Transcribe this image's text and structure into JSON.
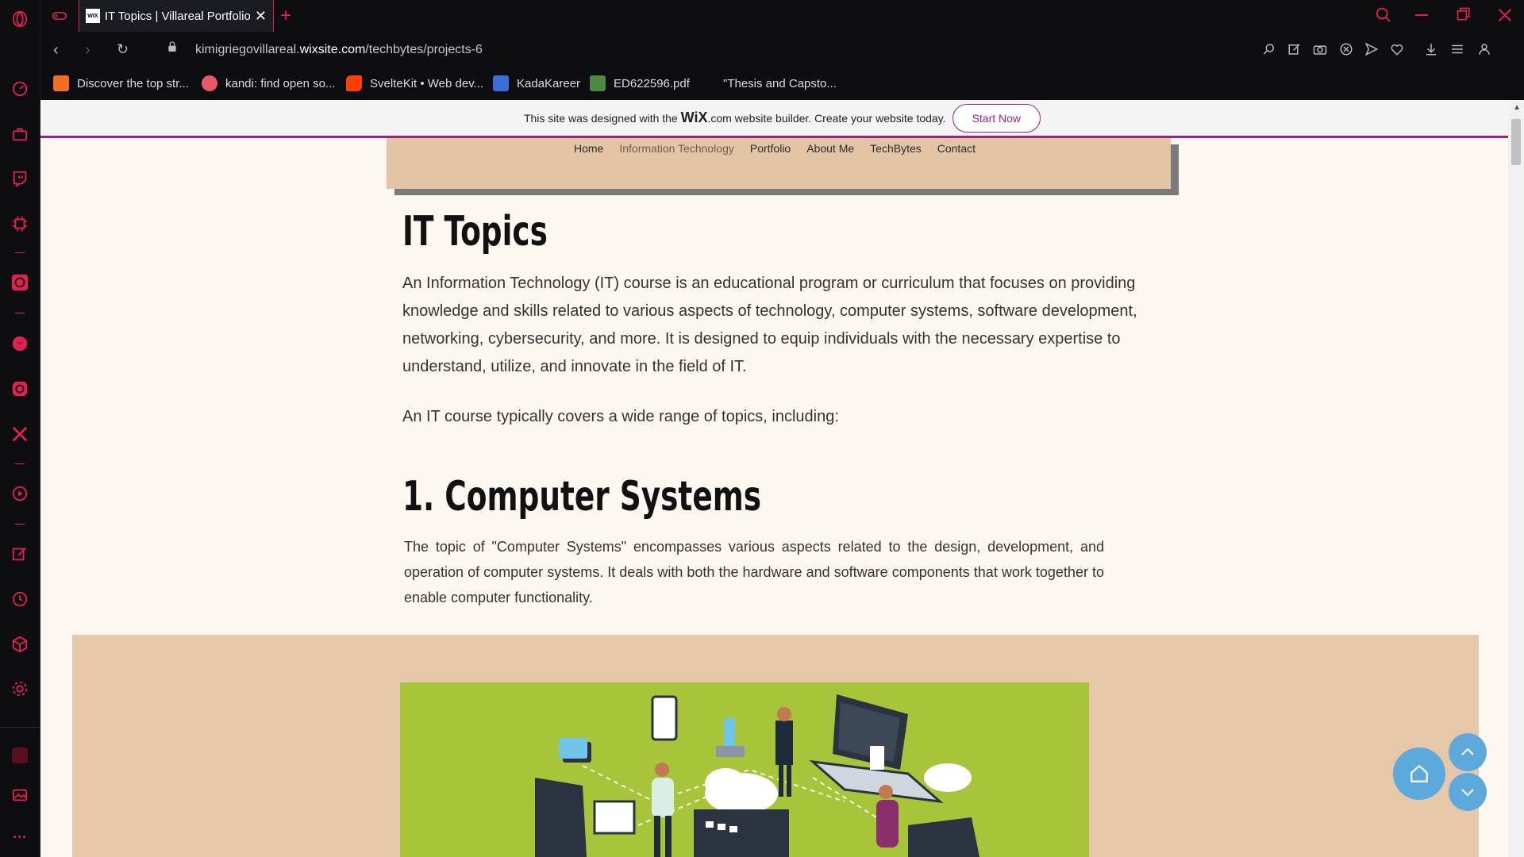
{
  "browser": {
    "tab": {
      "favicon_text": "WIX",
      "title": "IT Topics | Villareal Portfolio"
    },
    "url": {
      "host": "kimigriegovillareal.",
      "domain": "wixsite.com",
      "path": "/techbytes/projects-6"
    },
    "bookmarks": [
      {
        "label": "Discover the top str...",
        "color": "#f26f21"
      },
      {
        "label": "kandi: find open so...",
        "color": "#e8596a"
      },
      {
        "label": "SvelteKit • Web dev...",
        "color": "#ff3e00"
      },
      {
        "label": "KadaKareer",
        "color": "#3a6fd8"
      },
      {
        "label": "ED622596.pdf",
        "color": "#4d8a3f"
      },
      {
        "label": "\"Thesis and Capsto...",
        "color": "#0d0d12"
      }
    ]
  },
  "sidebar_icons": [
    "speed-dial-icon",
    "briefcase-icon",
    "twitch-icon",
    "chip-icon",
    "chatgpt-icon",
    "messenger-icon",
    "instagram-icon",
    "x-icon",
    "player-icon",
    "pinboard-icon",
    "history-icon",
    "extensions-icon",
    "settings-icon",
    "workspace-icon",
    "easy-setup-icon",
    "more-icon"
  ],
  "wix_banner": {
    "text_before": "This site was designed with the",
    "wix": "WiX",
    "text_after": ".com website builder. Create your website today.",
    "button": "Start Now"
  },
  "nav": [
    "Home",
    "Information Technology",
    "Portfolio",
    "About Me",
    "TechBytes",
    "Contact"
  ],
  "article": {
    "title": "IT Topics",
    "intro": "An Information Technology (IT) course is an educational program or curriculum that focuses on providing knowledge and skills related to various aspects of technology, computer systems, software development, networking, cybersecurity, and more. It is designed to equip individuals with the necessary expertise to understand, utilize, and innovate in the field of IT.",
    "lead": "An IT course typically covers a wide range of topics, including:",
    "section_title": "1. Computer Systems",
    "section_body": "The topic of \"Computer Systems\" encompasses various aspects related to the design, development, and operation of computer systems. It deals with both the hardware and software components that work together to enable computer functionality."
  },
  "colors": {
    "accent": "#e0234e",
    "wix_purple": "#a11f7f",
    "nav_bg": "#e3c4a7",
    "page_bg": "#fdf7f1",
    "illus_bg": "#a8c43a",
    "fab": "#5ea9db"
  }
}
